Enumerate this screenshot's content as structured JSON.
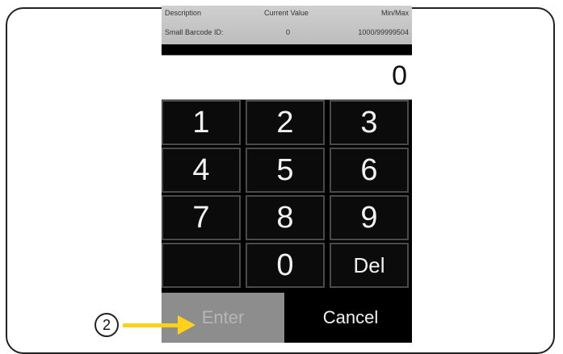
{
  "info": {
    "col_description": "Description",
    "col_current": "Current Value",
    "col_minmax": "Min/Max",
    "row_label": "Small Barcode ID:",
    "row_value": "0",
    "row_minmax": "1000/99999504"
  },
  "display": {
    "value": "0"
  },
  "keypad": {
    "k1": "1",
    "k2": "2",
    "k3": "3",
    "k4": "4",
    "k5": "5",
    "k6": "6",
    "k7": "7",
    "k8": "8",
    "k9": "9",
    "k0": "0",
    "del": "Del"
  },
  "actions": {
    "enter": "Enter",
    "cancel": "Cancel"
  },
  "callout": {
    "number": "2"
  },
  "colors": {
    "arrow": "#ffd21a",
    "enter_disabled": "#8d8d8d"
  }
}
